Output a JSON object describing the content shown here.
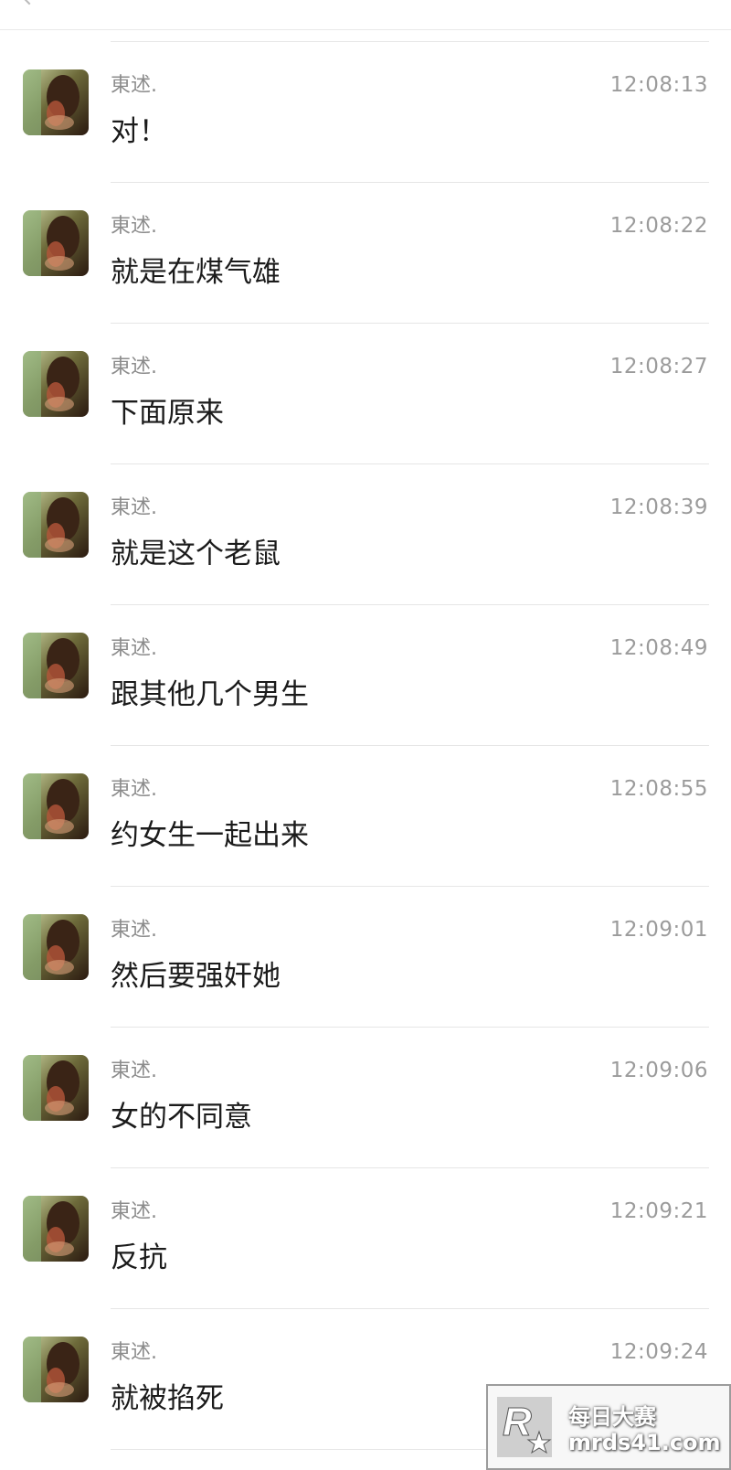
{
  "messages": [
    {
      "sender": "東述.",
      "time": "12:08:13",
      "text": "对！"
    },
    {
      "sender": "東述.",
      "time": "12:08:22",
      "text": "就是在煤气雄"
    },
    {
      "sender": "東述.",
      "time": "12:08:27",
      "text": "下面原来"
    },
    {
      "sender": "東述.",
      "time": "12:08:39",
      "text": "就是这个老鼠"
    },
    {
      "sender": "東述.",
      "time": "12:08:49",
      "text": "跟其他几个男生"
    },
    {
      "sender": "東述.",
      "time": "12:08:55",
      "text": "约女生一起出来"
    },
    {
      "sender": "東述.",
      "time": "12:09:01",
      "text": "然后要强奸她"
    },
    {
      "sender": "東述.",
      "time": "12:09:06",
      "text": "女的不同意"
    },
    {
      "sender": "東述.",
      "time": "12:09:21",
      "text": "反抗"
    },
    {
      "sender": "東述.",
      "time": "12:09:24",
      "text": "就被掐死"
    }
  ],
  "watermark": {
    "line1": "每日大赛",
    "line2": "mrds41.com"
  }
}
